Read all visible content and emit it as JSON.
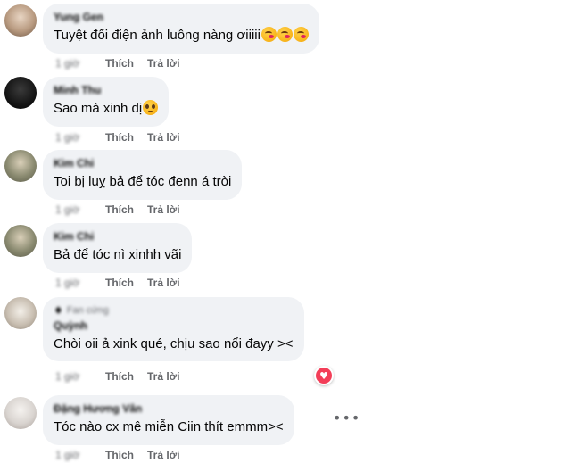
{
  "comments": [
    {
      "author": "Yung Gen",
      "text": "Tuyệt đối điện ảnh luông nàng ơiiiii",
      "emojis": [
        "kiss-emoji",
        "kiss-emoji",
        "kiss-emoji"
      ],
      "time": "1 giờ",
      "like_label": "Thích",
      "reply_label": "Trả lời",
      "avatar_color": "#b89a80"
    },
    {
      "author": "Minh Thu",
      "text": "Sao mà xinh dị",
      "emojis": [
        "pleading-emoji"
      ],
      "time": "1 giờ",
      "like_label": "Thích",
      "reply_label": "Trả lời",
      "avatar_color": "#151515"
    },
    {
      "author": "Kim Chi",
      "text": "Toi bị luỵ bả để tóc đenn á tròi",
      "emojis": [],
      "time": "1 giờ",
      "like_label": "Thích",
      "reply_label": "Trả lời",
      "avatar_color": "#8a8a70"
    },
    {
      "author": "Kim Chi",
      "text": "Bả để tóc nì xinhh vãi",
      "emojis": [],
      "time": "1 giờ",
      "like_label": "Thích",
      "reply_label": "Trả lời",
      "avatar_color": "#8a8a70"
    },
    {
      "author": "Quỳnh",
      "badge": "Fan cứng",
      "text": "Chòi oii ả xink qué, chịu sao nổi đayy ><",
      "emojis": [],
      "time": "1 giờ",
      "like_label": "Thích",
      "reply_label": "Trả lời",
      "avatar_color": "#c9bfb2"
    },
    {
      "author": "Đặng Hương Vân",
      "text": "Tóc nào cx mê miễn Ciin thít emmm><",
      "emojis": [],
      "time": "1 giờ",
      "like_label": "Thích",
      "reply_label": "Trả lời",
      "avatar_color": "#d9d4d0"
    }
  ],
  "reaction": {
    "icon": "heart-icon",
    "symbol": "♥",
    "color": "#f33e58"
  },
  "more_options": "•••"
}
